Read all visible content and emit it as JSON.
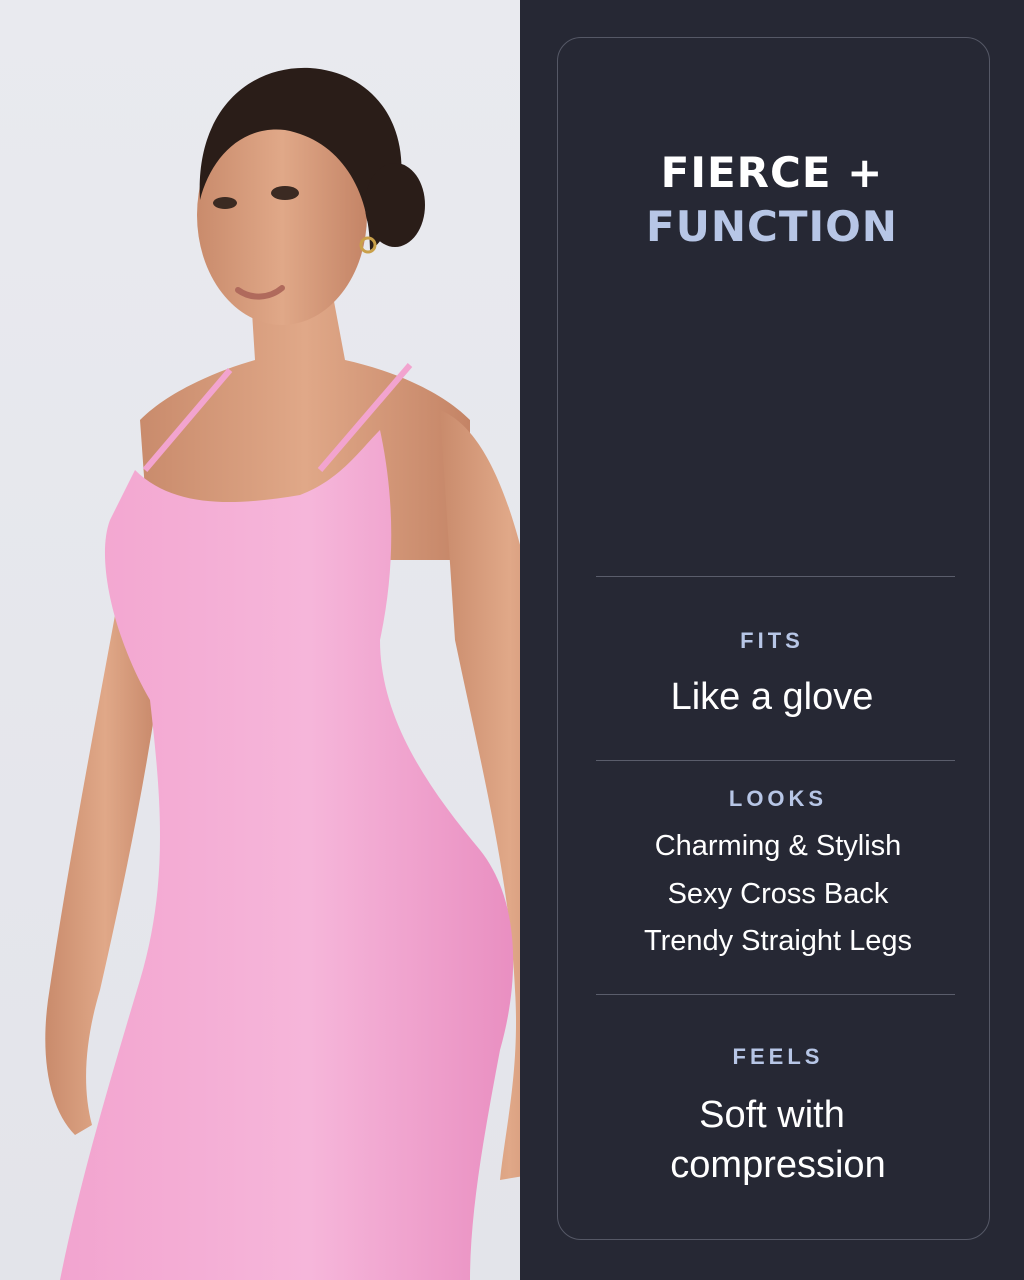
{
  "headline": {
    "line1": "FIERCE +",
    "line2": "FUNCTION"
  },
  "sections": {
    "fits": {
      "label": "FITS",
      "value": "Like a glove"
    },
    "looks": {
      "label": "LOOKS",
      "items": [
        "Charming & Stylish",
        "Sexy Cross Back",
        "Trendy Straight Legs"
      ]
    },
    "feels": {
      "label": "FEELS",
      "line1": "Soft with",
      "line2": "compression"
    }
  },
  "colors": {
    "panel_bg": "#262834",
    "accent": "#b7c6e6",
    "garment": "#f3a2cf",
    "photo_bg": "#e8e9ee"
  }
}
